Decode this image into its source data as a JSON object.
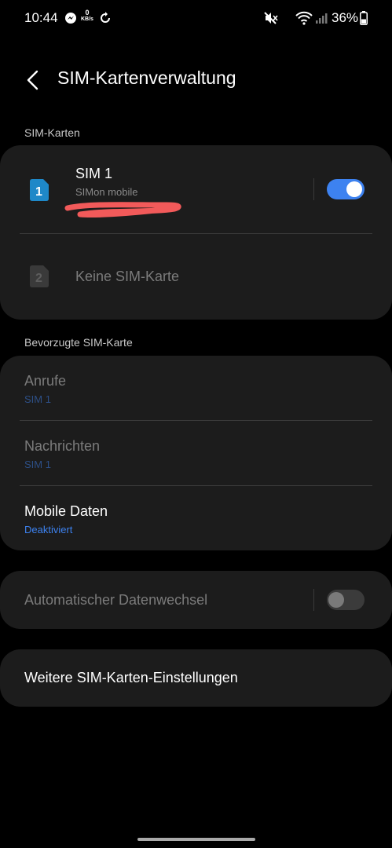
{
  "status_bar": {
    "time": "10:44",
    "speed_value": "0",
    "speed_unit": "KB/s",
    "battery": "36%"
  },
  "header": {
    "title": "SIM-Kartenverwaltung"
  },
  "sim_section": {
    "label": "SIM-Karten",
    "sim1": {
      "badge": "1",
      "title": "SIM 1",
      "subtitle": "SIMon mobile",
      "enabled": true
    },
    "sim2": {
      "badge": "2",
      "title": "Keine SIM-Karte"
    }
  },
  "preferred_section": {
    "label": "Bevorzugte SIM-Karte",
    "items": [
      {
        "title": "Anrufe",
        "value": "SIM 1"
      },
      {
        "title": "Nachrichten",
        "value": "SIM 1"
      },
      {
        "title": "Mobile Daten",
        "value": "Deaktiviert"
      }
    ]
  },
  "auto_switch": {
    "label": "Automatischer Datenwechsel",
    "enabled": false
  },
  "more_settings": {
    "label": "Weitere SIM-Karten-Einstellungen"
  },
  "colors": {
    "accent": "#3d82f0",
    "sim1_badge": "#1e88c8",
    "redaction": "#f25a5a"
  }
}
